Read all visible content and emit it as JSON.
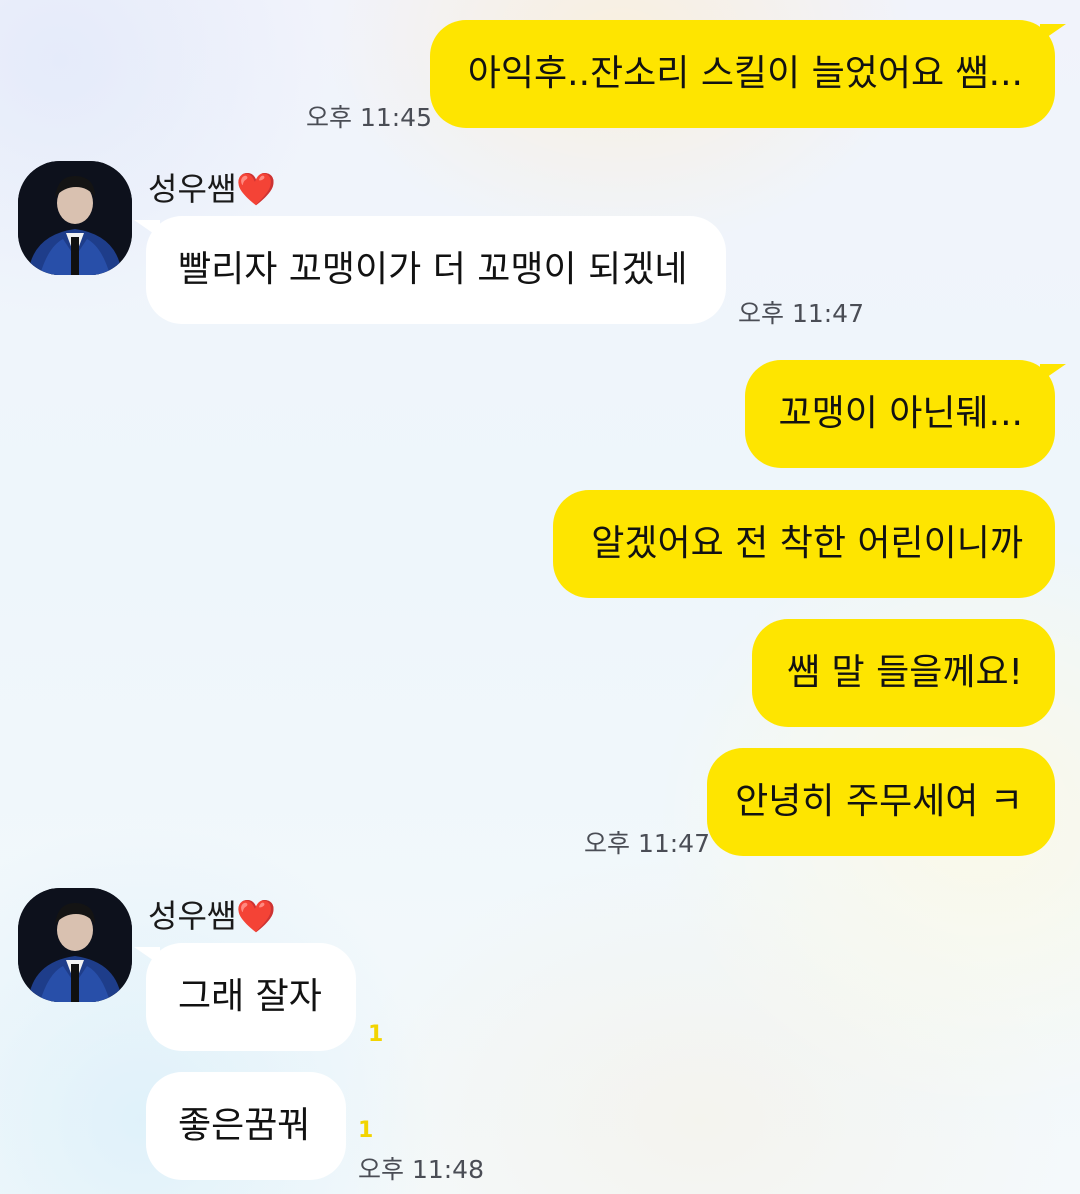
{
  "messages": {
    "m1": {
      "text": "아익후..잔소리 스킬이 늘었어요 쌤...",
      "time": "오후 11:45"
    },
    "sender1": {
      "name": "성우쌤",
      "emoji": "❤️"
    },
    "m2": {
      "text": "빨리자 꼬맹이가 더 꼬맹이 되겠네",
      "time": "오후 11:47"
    },
    "m3": {
      "text": "꼬맹이 아닌뒈..."
    },
    "m4": {
      "text": "알겠어요 전 착한 어린이니까"
    },
    "m5": {
      "text": "쌤 말 들을께요!"
    },
    "m6": {
      "text": "안녕히 주무세여 ㅋ",
      "time": "오후 11:47"
    },
    "sender2": {
      "name": "성우쌤",
      "emoji": "❤️"
    },
    "m7": {
      "text": "그래 잘자",
      "unread": "1"
    },
    "m8": {
      "text": "좋은꿈꿔",
      "unread": "1",
      "time": "오후 11:48"
    }
  },
  "colors": {
    "my_bubble": "#fee500",
    "their_bubble": "#ffffff",
    "unread": "#f2d400",
    "heart": "#e0202a"
  },
  "icons": {
    "avatar": "profile-photo"
  }
}
